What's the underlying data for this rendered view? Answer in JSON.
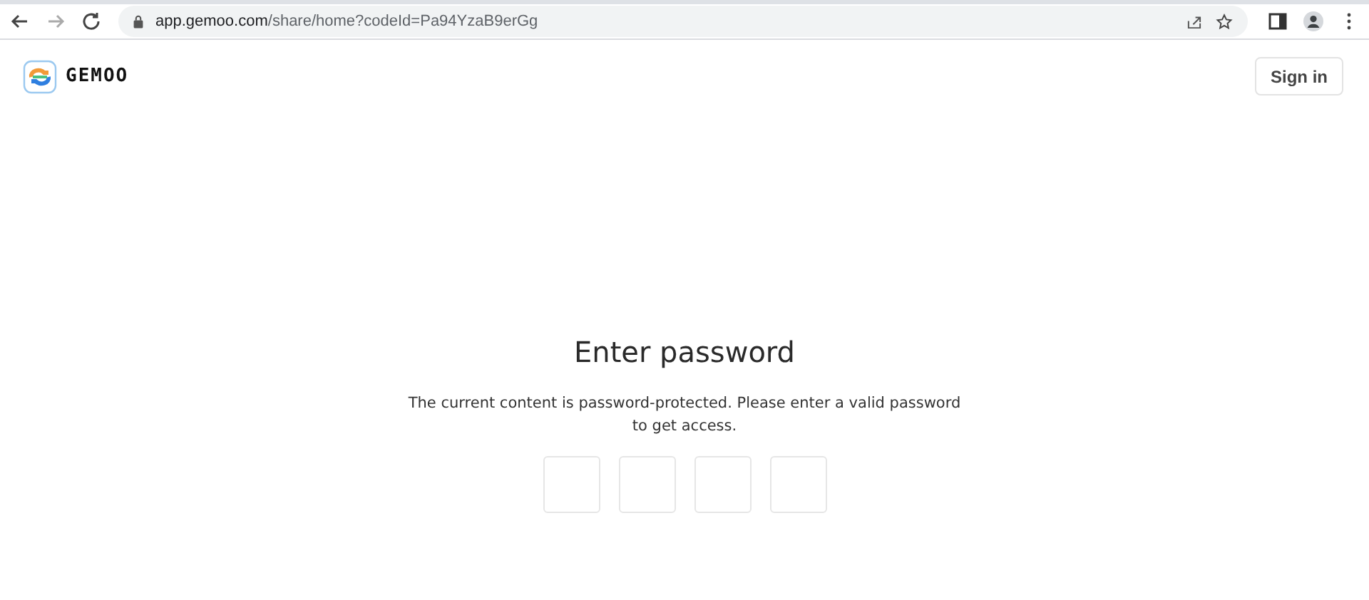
{
  "browser": {
    "url_host": "app.gemoo.com",
    "url_path": "/share/home?codeId=Pa94YzaB9erGg"
  },
  "header": {
    "logo_text": "GEMOO",
    "sign_in": "Sign in"
  },
  "dialog": {
    "title": "Enter password",
    "message": "The current content is password-protected. Please enter a valid password to get access.",
    "code_boxes": [
      {
        "kind": "digit"
      },
      {
        "kind": "digit"
      },
      {
        "kind": "digit"
      },
      {
        "kind": "digit"
      }
    ]
  }
}
